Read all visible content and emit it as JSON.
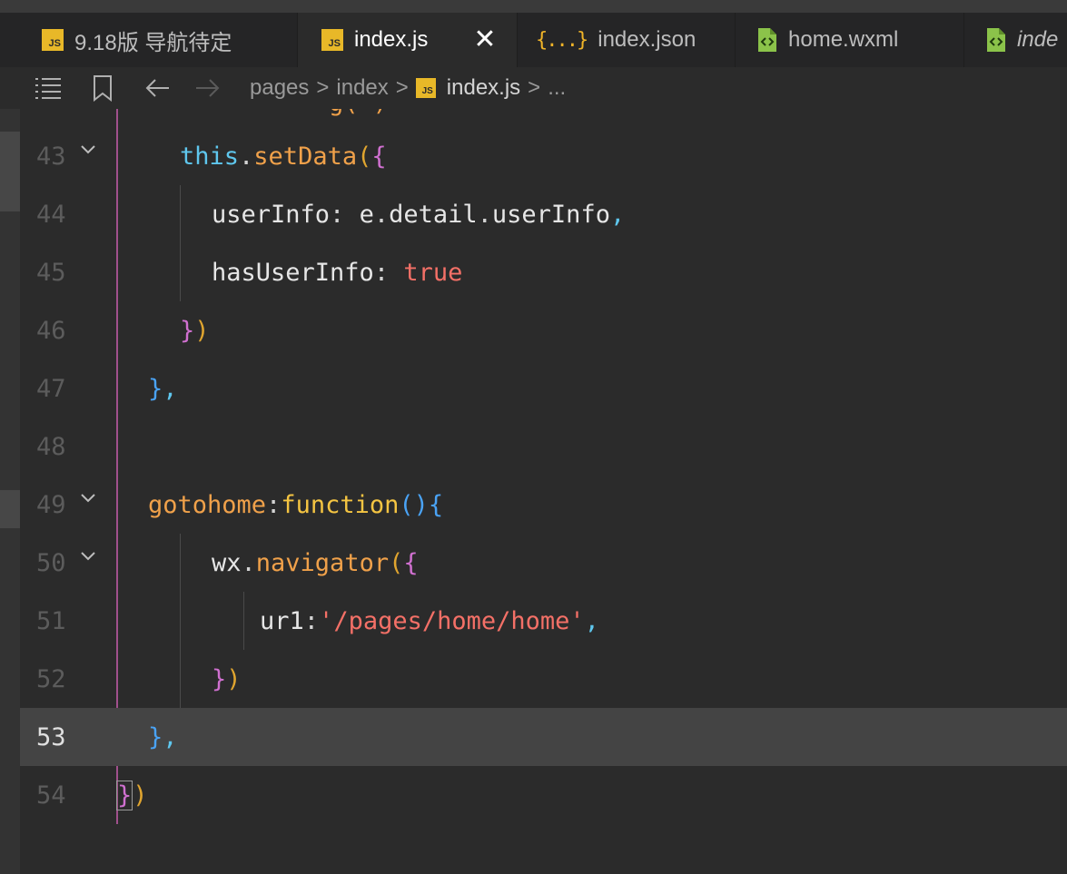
{
  "tabs": [
    {
      "label": "9.18版 导航待定",
      "icon": "js-file-icon",
      "active": false
    },
    {
      "label": "index.js",
      "icon": "js-file-icon",
      "active": true
    },
    {
      "label": "index.json",
      "icon": "json-file-icon",
      "active": false
    },
    {
      "label": "home.wxml",
      "icon": "wxml-file-icon",
      "active": false
    },
    {
      "label": "inde",
      "icon": "wxml-file-icon",
      "active": false
    }
  ],
  "js_badge": "JS",
  "json_badge": "{...}",
  "close_glyph": "✕",
  "breadcrumb": {
    "items": [
      "pages",
      "index",
      "index.js",
      "..."
    ],
    "separator": ">"
  },
  "line_numbers": [
    "43",
    "44",
    "45",
    "46",
    "47",
    "48",
    "49",
    "50",
    "51",
    "52",
    "53",
    "54"
  ],
  "current_line": "53",
  "code": {
    "l43": {
      "this": "this",
      "dot": ".",
      "fn": "setData",
      "p1": "(",
      "p2": "{"
    },
    "l44": {
      "key": "userInfo",
      "colon": ": ",
      "obj": "e",
      "dot1": ".",
      "p1": "detail",
      "dot2": ".",
      "p2": "userInfo",
      "comma": ","
    },
    "l45": {
      "key": "hasUserInfo",
      "colon": ": ",
      "val": "true"
    },
    "l46": {
      "b1": "}",
      "b2": ")"
    },
    "l47": {
      "b": "}",
      "comma": ","
    },
    "l49": {
      "name": "gotohome",
      "colon": ":",
      "kw": "function",
      "parens": "()",
      "brace": "{"
    },
    "l50": {
      "obj": "wx",
      "dot": ".",
      "fn": "navigator",
      "p1": "(",
      "p2": "{"
    },
    "l51": {
      "key": "ur1",
      "colon": ":",
      "q1": "'",
      "str": "/pages/home/home",
      "q2": "'",
      "comma": ","
    },
    "l52": {
      "b1": "}",
      "b2": ")"
    },
    "l53": {
      "b": "}",
      "comma": ","
    },
    "l54": {
      "b1": "}",
      "b2": ")"
    }
  },
  "colors": {
    "background": "#2b2b2b",
    "keyword": "#5fc7ee",
    "function": "#f0a14a",
    "string": "#f47067",
    "current_line": "#444444"
  }
}
